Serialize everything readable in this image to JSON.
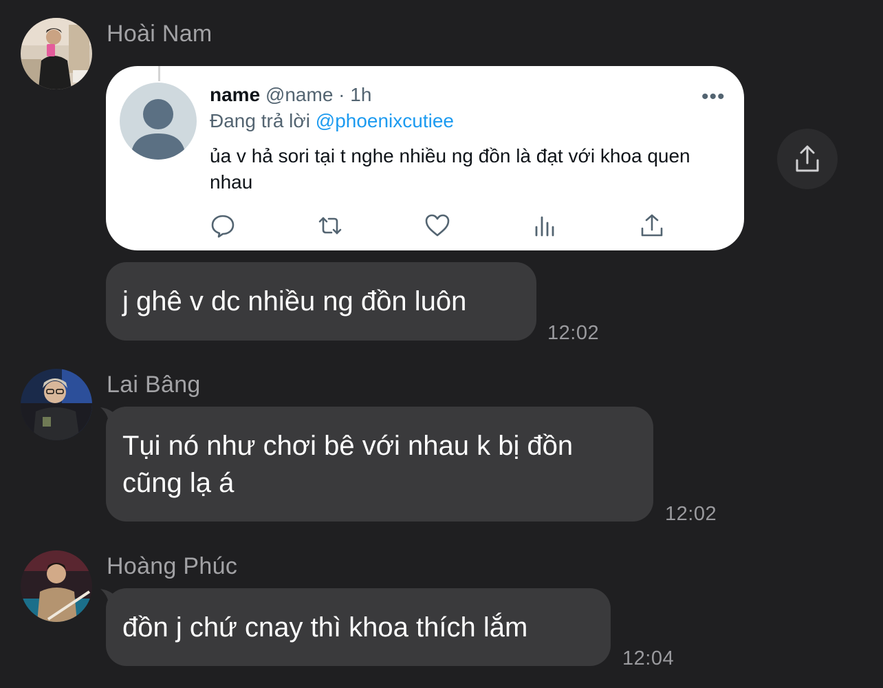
{
  "messages": [
    {
      "sender": "Hoài Nam",
      "avatar_icon": "avatar-photo",
      "shared_tweet": {
        "name": "name",
        "handle_time": "@name · 1h",
        "reply_label": "Đang trả lời",
        "reply_to": "@phoenixcutiee",
        "body": "ủa v hả sori tại t nghe nhiều ng đồn là đạt với khoa quen nhau",
        "more_label": "•••",
        "actions": [
          "reply-icon",
          "retweet-icon",
          "like-icon",
          "views-icon",
          "share-icon"
        ]
      },
      "text": "j ghê v dc nhiều ng đồn luôn",
      "time": "12:02"
    },
    {
      "sender": "Lai Bâng",
      "avatar_icon": "avatar-photo",
      "text": "Tụi nó như chơi bê với nhau k bị đồn cũng lạ á",
      "time": "12:02"
    },
    {
      "sender": "Hoàng Phúc",
      "avatar_icon": "avatar-photo",
      "text": "đồn j chứ cnay thì khoa thích lắm",
      "time": "12:04"
    }
  ],
  "colors": {
    "background": "#1f1f21",
    "bubble": "#3a3a3c",
    "mention": "#1d9bf0"
  }
}
